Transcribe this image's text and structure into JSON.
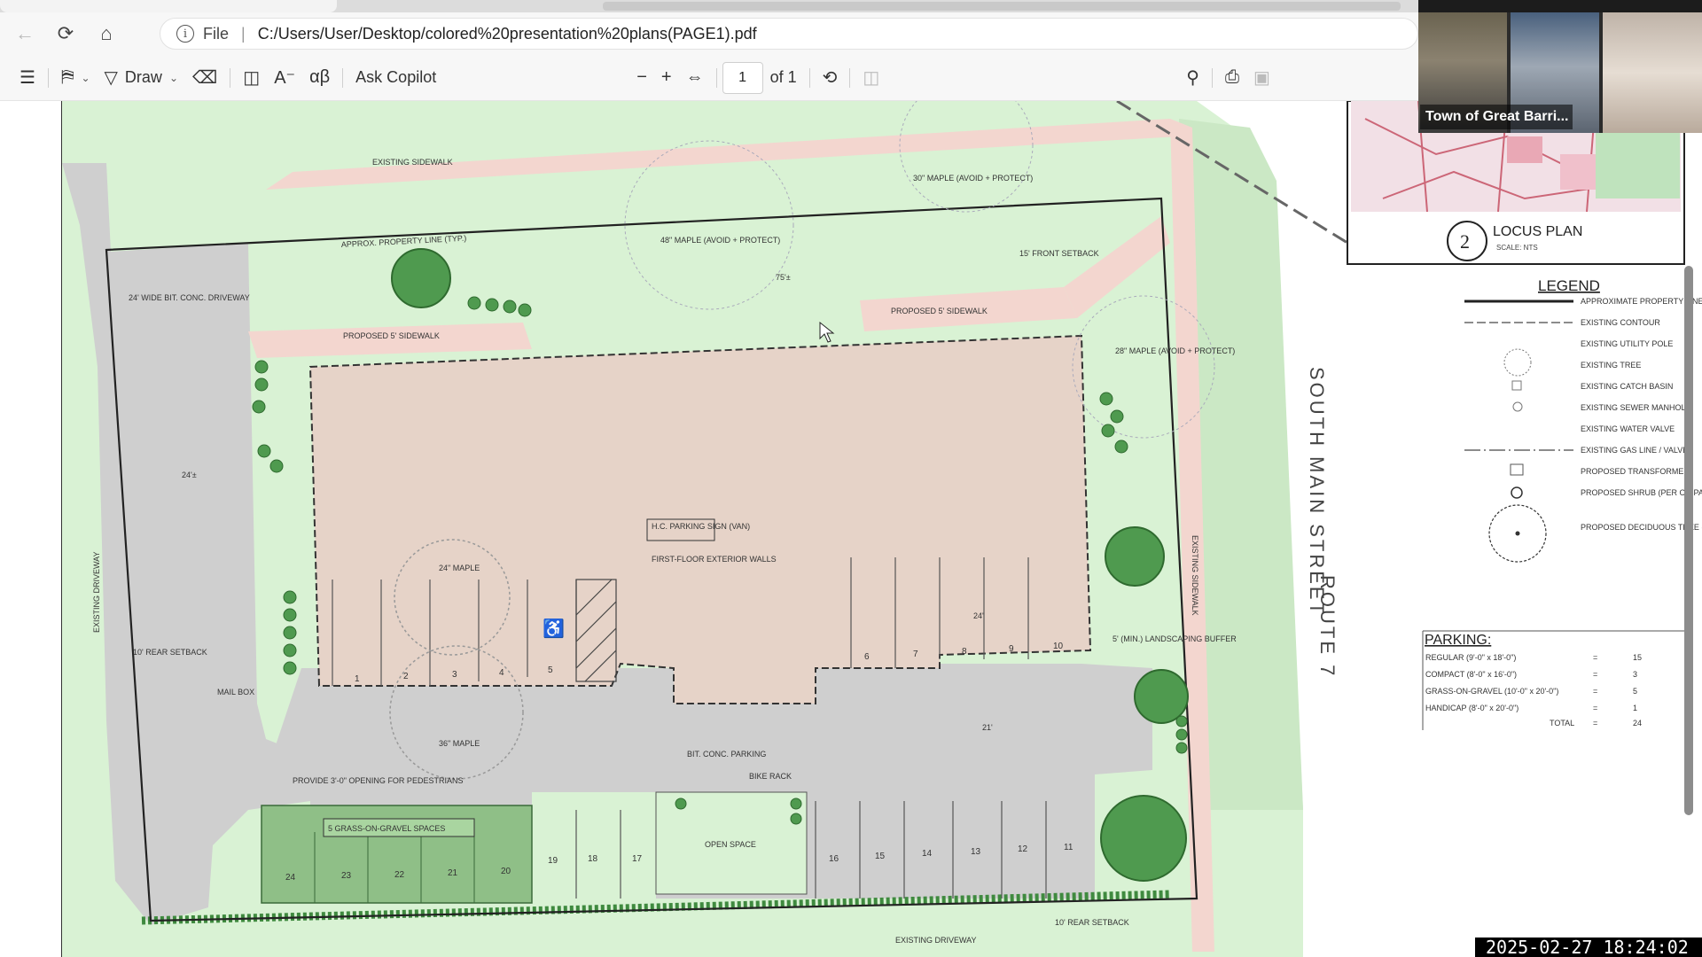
{
  "browser": {
    "nav": {
      "back_icon": "back-arrow-icon",
      "reload_icon": "reload-icon",
      "home_icon": "home-icon"
    },
    "address": {
      "scheme_label": "File",
      "url": "C:/Users/User/Desktop/colored%20presentation%20plans(PAGE1).pdf"
    }
  },
  "pdf_toolbar": {
    "draw_label": "Draw",
    "copilot_label": "Ask Copilot",
    "page_current": "1",
    "page_total": "of 1"
  },
  "plan": {
    "labels": {
      "existing_sidewalk": "EXISTING SIDEWALK",
      "property_line": "APPROX. PROPERTY LINE (TYP.)",
      "wide_driveway": "24' WIDE BIT. CONC. DRIVEWAY",
      "proposed_sidewalk_left": "PROPOSED 5' SIDEWALK",
      "proposed_sidewalk_right": "PROPOSED 5' SIDEWALK",
      "maple_top": "48\" MAPLE (AVOID + PROTECT)",
      "maple_top_right": "30\" MAPLE (AVOID + PROTECT)",
      "maple_right": "28\" MAPLE (AVOID + PROTECT)",
      "front_setback": "15' FRONT SETBACK",
      "parking_sign": "H.C. PARKING SIGN (VAN)",
      "first_floor": "FIRST-FLOOR EXTERIOR WALLS",
      "maple_mid": "24\" MAPLE",
      "maple_low": "36\" MAPLE",
      "mail_box": "MAIL BOX",
      "rear_setback": "10' REAR SETBACK",
      "existing_driveway_left": "EXISTING DRIVEWAY",
      "existing_driveway_bottom": "EXISTING DRIVEWAY",
      "bit_conc_parking": "BIT. CONC. PARKING",
      "bike_rack": "BIKE RACK",
      "open_space": "OPEN SPACE",
      "gravel_spaces": "5 GRASS-ON-GRAVEL SPACES",
      "fence_opening": "PROVIDE 3'-0\" OPENING FOR PEDESTRIANS",
      "landscaping_buffer": "5' (MIN.) LANDSCAPING BUFFER",
      "rear_setback_bottom": "10' REAR SETBACK",
      "existing_sidewalk_right": "EXISTING SIDEWALK",
      "street_name": "SOUTH MAIN STREET",
      "route": "ROUTE 7",
      "dim_75": "75'±",
      "dim_24": "24'",
      "dim_21": "21'",
      "dim_24_left": "24'±"
    },
    "stall_numbers": [
      "1",
      "2",
      "3",
      "4",
      "5",
      "6",
      "7",
      "8",
      "9",
      "10",
      "11",
      "12",
      "13",
      "14",
      "15",
      "16",
      "17",
      "18",
      "19",
      "20",
      "21",
      "22",
      "23",
      "24"
    ]
  },
  "locus": {
    "number": "2",
    "title": "LOCUS PLAN",
    "scale": "SCALE: NTS"
  },
  "legend": {
    "title": "LEGEND",
    "items": [
      "APPROXIMATE PROPERTY LINE",
      "EXISTING CONTOUR",
      "EXISTING UTILITY POLE",
      "EXISTING TREE",
      "EXISTING CATCH BASIN",
      "EXISTING SEWER MANHOLE",
      "EXISTING WATER VALVE",
      "EXISTING GAS LINE / VALVE",
      "PROPOSED TRANSFORMER",
      "PROPOSED SHRUB (PER OR PAR ZONING)",
      "PROPOSED DECIDUOUS TREE (PER OR PAR ZONING)"
    ]
  },
  "parking_table": {
    "title": "PARKING:",
    "rows": [
      {
        "label": "REGULAR (9'-0\" x 18'-0\")",
        "eq": "=",
        "value": "15"
      },
      {
        "label": "COMPACT (8'-0\" x 16'-0\")",
        "eq": "=",
        "value": "3"
      },
      {
        "label": "GRASS-ON-GRAVEL (10'-0\" x 20'-0\")",
        "eq": "=",
        "value": "5"
      },
      {
        "label": "HANDICAP (8'-0\" x 20'-0\")",
        "eq": "=",
        "value": "1"
      }
    ],
    "total_label": "TOTAL",
    "total_eq": "=",
    "total_value": "24"
  },
  "video_call": {
    "participant_name": "Town of Great Barri..."
  },
  "overlay": {
    "timestamp": "2025-02-27 18:24:02"
  },
  "colors": {
    "grass": "#d9f2d4",
    "building": "#e6d3c8",
    "pavement": "#cfcfcf",
    "sidewalk": "#f3d6cf",
    "gravel": "#8fbf87",
    "tree": "#4f9a4f"
  }
}
